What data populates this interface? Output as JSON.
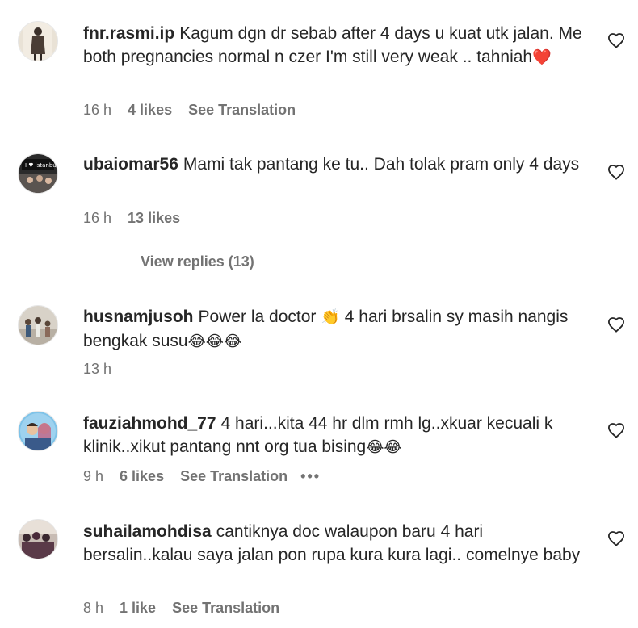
{
  "comments": [
    {
      "username": "fnr.rasmi.ip",
      "text": "Kagum dgn dr sebab after 4 days u kuat utk jalan. Me both pregnancies normal n czer I'm still very weak .. tahniah",
      "emoji": "❤️",
      "time": "16 h",
      "likes": "4 likes",
      "translation": "See Translation",
      "more": ""
    },
    {
      "username": "ubaiomar56",
      "text": "Mami tak pantang ke tu.. Dah tolak pram only 4 days",
      "emoji": "",
      "time": "16 h",
      "likes": "13 likes",
      "translation": "",
      "more": ""
    },
    {
      "username": "husnamjusoh",
      "text_before": "Power la doctor ",
      "clap": "👏",
      "text": " 4 hari brsalin sy masih nangis bengkak susu",
      "emoji": "😂😂😂",
      "time": "13 h",
      "likes": "",
      "translation": "",
      "more": ""
    },
    {
      "username": "fauziahmohd_77",
      "text": "4 hari...kita 44 hr dlm rmh lg..xkuar kecuali k klinik..xikut pantang nnt org tua bising",
      "emoji": "😂😂",
      "time": "9 h",
      "likes": "6 likes",
      "translation": "See Translation",
      "more": "•••"
    },
    {
      "username": "suhailamohdisa",
      "text": "cantiknya doc walaupon baru 4 hari bersalin..kalau saya jalan pon rupa kura kura lagi.. comelnye baby",
      "emoji": "",
      "time": "8 h",
      "likes": "1 like",
      "translation": "See Translation",
      "more": ""
    }
  ],
  "view_replies": "View replies (13)",
  "colors": {
    "text": "#262626",
    "secondary": "#737373",
    "heart_emoji": "#e0245e",
    "background": "#ffffff"
  },
  "icons": {
    "like": "heart-outline-icon",
    "more": "more-options-icon"
  }
}
